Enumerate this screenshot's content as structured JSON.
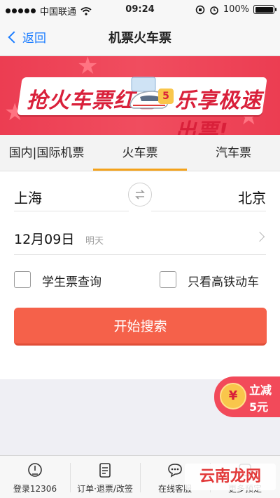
{
  "status_bar": {
    "carrier": "中国联通",
    "time": "09:24",
    "battery": "100%"
  },
  "nav": {
    "back_label": "返回",
    "title": "机票火车票"
  },
  "banner": {
    "text_left": "抢火车票红包",
    "badge": "5",
    "text_right": "乐享极速出票!"
  },
  "tabs": [
    {
      "label": "国内|国际机票",
      "selected": false
    },
    {
      "label": "火车票",
      "selected": true
    },
    {
      "label": "汽车票",
      "selected": false
    }
  ],
  "form": {
    "from_city": "上海",
    "to_city": "北京",
    "date": "12月09日",
    "date_hint": "明天",
    "student_label": "学生票查询",
    "highspeed_label": "只看高铁动车",
    "search_label": "开始搜索"
  },
  "promo": {
    "coin": "¥",
    "line1": "立减",
    "line2": "5元"
  },
  "bottom_nav": [
    {
      "label": "登录12306",
      "icon": "login-12306-icon"
    },
    {
      "label": "订单·退票/改签",
      "icon": "order-clipboard-icon"
    },
    {
      "label": "在线客服",
      "icon": "chat-bubble-icon"
    },
    {
      "label": "更多预定",
      "icon": "more-icon"
    }
  ],
  "watermark": "云南龙网",
  "colors": {
    "accent_blue": "#1a7cff",
    "banner_red": "#ec3d52",
    "tab_indicator": "#f4a21a",
    "search_button": "#f5614a"
  }
}
